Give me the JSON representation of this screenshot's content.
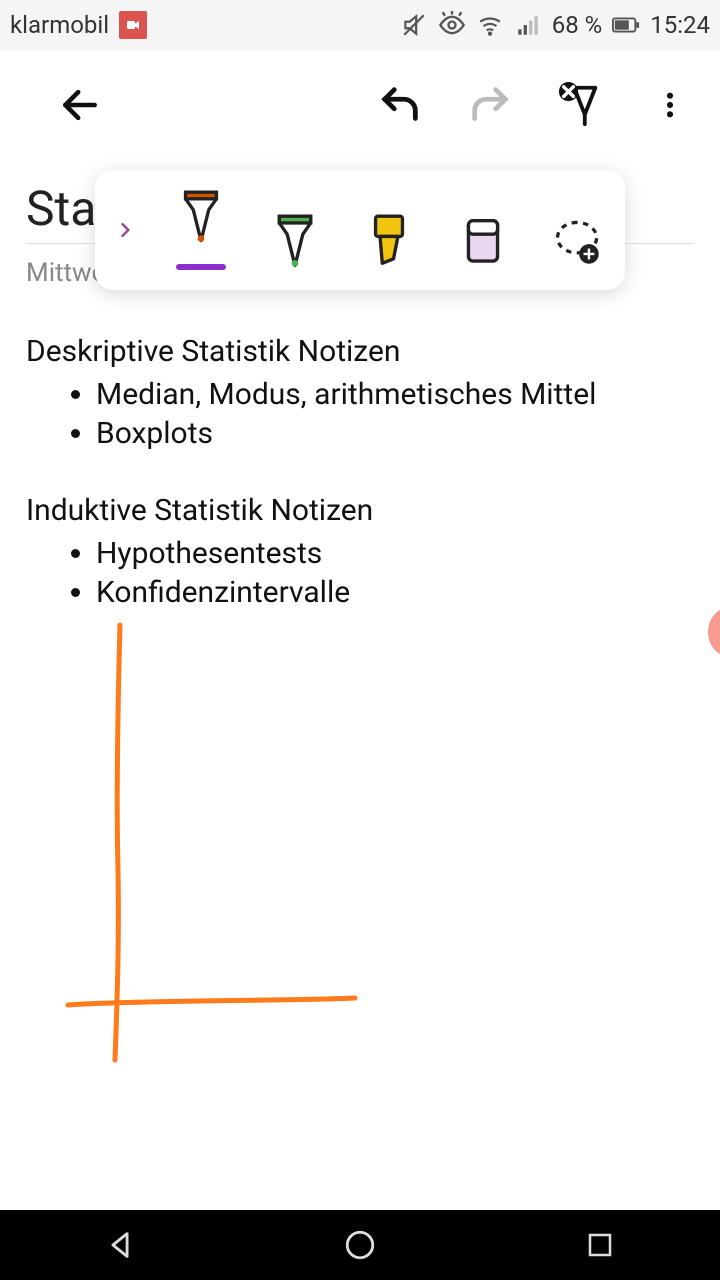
{
  "status": {
    "carrier": "klarmobil",
    "battery_pct": "68 %",
    "time": "15:24"
  },
  "page": {
    "title_visible": "Sta",
    "meta_visible": "Mittwo"
  },
  "sections": [
    {
      "heading": "Deskriptive Statistik Notizen",
      "items": [
        "Median, Modus, arithmetisches Mittel",
        "Boxplots"
      ]
    },
    {
      "heading": "Induktive Statistik Notizen",
      "items": [
        "Hypothesentests",
        "Konfidenzintervalle"
      ]
    }
  ],
  "tools": {
    "pen_red": {
      "stroke": "#222",
      "tip": "#d35400"
    },
    "pen_green": {
      "stroke": "#222",
      "tip": "#4caf50"
    },
    "highlighter": {
      "body": "#f1c40f"
    },
    "eraser": {
      "body": "#e9d6ef"
    }
  },
  "drawing": {
    "stroke": "#ff7a1a",
    "width": "5"
  }
}
